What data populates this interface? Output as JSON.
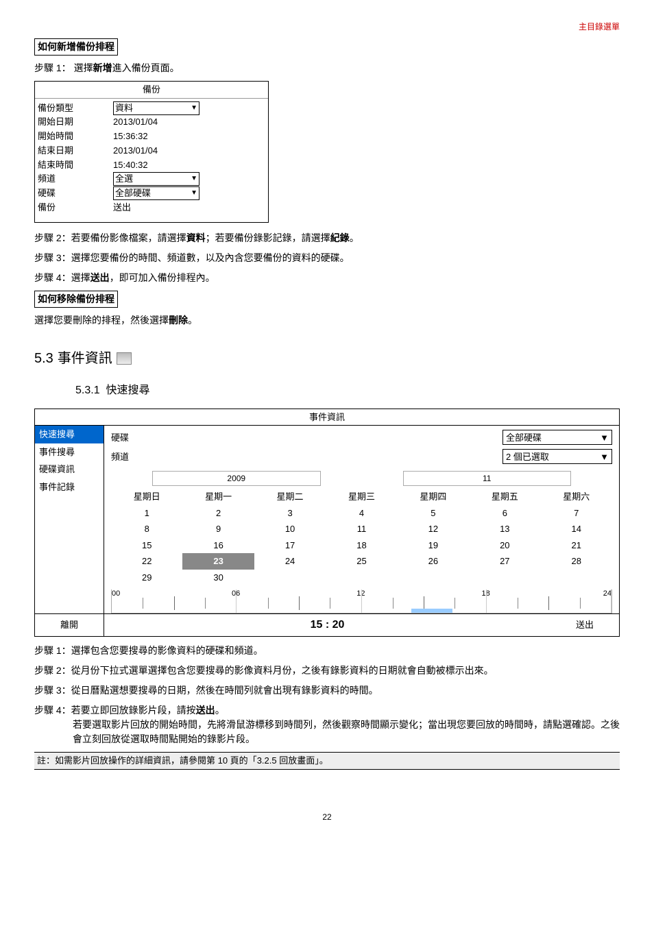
{
  "header": {
    "menu_link": "主目錄選單"
  },
  "section_add": {
    "title": "如何新增備份排程",
    "step1_prefix": "步驟 1：",
    "step1_a": "選擇",
    "step1_bold": "新增",
    "step1_b": "進入備份頁面。",
    "step2": "步驟 2：若要備份影像檔案，請選擇",
    "step2_bold1": "資料",
    "step2_mid": "；若要備份錄影記錄，請選擇",
    "step2_bold2": "紀錄",
    "step2_end": "。",
    "step3": "步驟 3：選擇您要備份的時間、頻道數，以及內含您要備份的資料的硬碟。",
    "step4_a": "步驟 4：選擇",
    "step4_bold": "送出",
    "step4_b": "，即可加入備份排程內。"
  },
  "backup_table": {
    "title": "備份",
    "rows": {
      "type_label": "備份類型",
      "type_value": "資料",
      "start_date_label": "開始日期",
      "start_date_value": "2013/01/04",
      "start_time_label": "開始時間",
      "start_time_value": "15:36:32",
      "end_date_label": "結束日期",
      "end_date_value": "2013/01/04",
      "end_time_label": "結束時間",
      "end_time_value": "15:40:32",
      "channel_label": "頻道",
      "channel_value": "全選",
      "hdd_label": "硬碟",
      "hdd_value": "全部硬碟",
      "backup_label": "備份",
      "backup_value": "送出"
    }
  },
  "section_remove": {
    "title": "如何移除備份排程",
    "text_a": "選擇您要刪除的排程，然後選擇",
    "text_bold": "刪除",
    "text_b": "。"
  },
  "section_53": {
    "num": "5.3",
    "title": "事件資訊"
  },
  "section_531": {
    "num": "5.3.1",
    "title": "快速搜尋"
  },
  "event_panel": {
    "title": "事件資訊",
    "sidebar": {
      "quick": "快速搜尋",
      "event": "事件搜尋",
      "hdd": "硬碟資訊",
      "log": "事件記錄"
    },
    "hdd_label": "硬碟",
    "hdd_value": "全部硬碟",
    "ch_label": "頻道",
    "ch_value": "2 個已選取",
    "year": "2009",
    "month": "11",
    "dow": {
      "sun": "星期日",
      "mon": "星期一",
      "tue": "星期二",
      "wed": "星期三",
      "thu": "星期四",
      "fri": "星期五",
      "sat": "星期六"
    },
    "cal": {
      "r1": [
        "1",
        "2",
        "3",
        "4",
        "5",
        "6",
        "7"
      ],
      "r2": [
        "8",
        "9",
        "10",
        "11",
        "12",
        "13",
        "14"
      ],
      "r3": [
        "15",
        "16",
        "17",
        "18",
        "19",
        "20",
        "21"
      ],
      "r4": [
        "22",
        "23",
        "24",
        "25",
        "26",
        "27",
        "28"
      ],
      "r5": [
        "29",
        "30",
        "",
        "",
        "",
        "",
        ""
      ]
    },
    "hours": {
      "h0": "00",
      "h6": "06",
      "h12": "12",
      "h18": "18",
      "h24": "24"
    },
    "footer": {
      "exit": "離開",
      "time": "15 : 20",
      "submit": "送出"
    }
  },
  "steps2": {
    "s1": "步驟 1：選擇包含您要搜尋的影像資料的硬碟和頻道。",
    "s2": "步驟 2：從月份下拉式選單選擇包含您要搜尋的影像資料月份，之後有錄影資料的日期就會自動被標示出來。",
    "s3": "步驟 3：從日曆點選想要搜尋的日期，然後在時間列就會出現有錄影資料的時間。",
    "s4a": "步驟 4：若要立即回放錄影片段，請按",
    "s4_bold": "送出",
    "s4b": "。",
    "s4c": "若要選取影片回放的開始時間，先將滑鼠游標移到時間列，然後觀察時間顯示變化；當出現您要回放的時間時，請點選確認。之後會立刻回放從選取時間點開始的錄影片段。"
  },
  "note": {
    "text_a": "註：如需影片回放操作的詳細資訊，請參閱第 10 頁的「",
    "ref": "3.2.5 回放畫面",
    "text_b": "」。"
  },
  "page_number": "22"
}
